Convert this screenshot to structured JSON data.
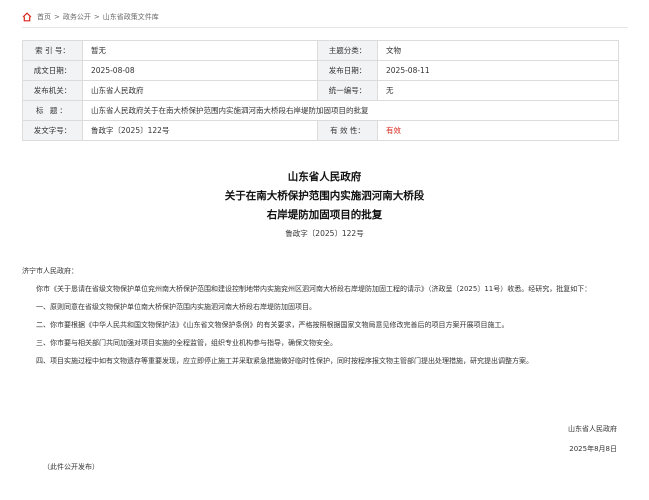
{
  "breadcrumb": {
    "items": [
      "首页",
      "政务公开",
      "山东省政策文件库"
    ],
    "separator": ">"
  },
  "meta": {
    "index_label": "索 引 号：",
    "index_value": "暂无",
    "category_label": "主题分类：",
    "category_value": "文物",
    "date_label": "成文日期：",
    "date_value": "2025-08-08",
    "publish_label": "发布日期：",
    "publish_value": "2025-08-11",
    "issuer_label": "发布机关：",
    "issuer_value": "山东省人民政府",
    "uniform_label": "统一编号：",
    "uniform_value": "无",
    "title_label": "标 题：",
    "title_value": "山东省人民政府关于在南大桥保护范围内实施泗河南大桥段右岸堤防加固项目的批复",
    "docno_label": "发文字号：",
    "docno_value": "鲁政字〔2025〕122号",
    "validity_label": "有 效 性：",
    "validity_value": "有效"
  },
  "document": {
    "title_line1": "山东省人民政府",
    "title_line2": "关于在南大桥保护范围内实施泗河南大桥段",
    "title_line3": "右岸堤防加固项目的批复",
    "number": "鲁政字〔2025〕122号",
    "addressee": "济宁市人民政府：",
    "para1": "你市《关于恳请在省级文物保护单位兖州南大桥保护范围和建设控制地带内实施兖州区泗河南大桥段右岸堤防加固工程的请示》（济政呈〔2025〕11号）收悉。经研究，批复如下：",
    "item1": "一、原则同意在省级文物保护单位南大桥保护范围内实施泗河南大桥段右岸堤防加固项目。",
    "item2": "二、你市要根据《中华人民共和国文物保护法》《山东省文物保护条例》的有关要求，严格按照根据国家文物局意见修改完善后的项目方案开展项目施工。",
    "item3": "三、你市要与相关部门共同加强对项目实施的全程监管，组织专业机构参与指导，确保文物安全。",
    "item4": "四、项目实施过程中如有文物遗存等重要发现，应立即停止施工并采取紧急措施做好临时性保护，同时按程序报文物主管部门提出处理措施，研究提出调整方案。",
    "signature": "山东省人民政府",
    "sign_date": "2025年8月8日",
    "footnote": "（此件公开发布）"
  },
  "colors": {
    "accent_red": "#d9261c",
    "table_label_bg": "#f2f3f5",
    "border": "#dcdcdc"
  }
}
